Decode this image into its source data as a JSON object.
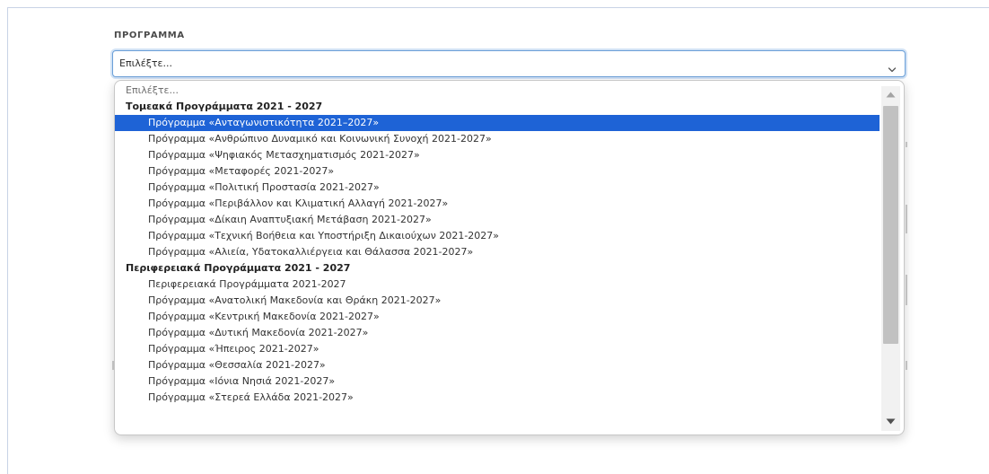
{
  "form": {
    "label": "ΠΡΟΓΡΑΜΜΑ",
    "selected_value": "Επιλέξτε..."
  },
  "dropdown": {
    "placeholder": "Επιλέξτε...",
    "groups": [
      {
        "label": "Τομεακά Προγράμματα 2021 - 2027",
        "options": [
          "Πρόγραμμα «Ανταγωνιστικότητα 2021–2027»",
          "Πρόγραμμα «Ανθρώπινο Δυναμικό και Κοινωνική Συνοχή 2021-2027»",
          "Πρόγραμμα «Ψηφιακός Μετασχηματισμός 2021-2027»",
          "Πρόγραμμα «Μεταφορές 2021-2027»",
          "Πρόγραμμα «Πολιτική Προστασία 2021-2027»",
          "Πρόγραμμα «Περιβάλλον και Κλιματική Αλλαγή 2021-2027»",
          "Πρόγραμμα «Δίκαιη Αναπτυξιακή Μετάβαση 2021-2027»",
          "Πρόγραμμα «Τεχνική Βοήθεια και Υποστήριξη Δικαιούχων 2021-2027»",
          "Πρόγραμμα «Αλιεία, Υδατοκαλλιέργεια και Θάλασσα 2021-2027»"
        ]
      },
      {
        "label": "Περιφερειακά Προγράμματα 2021 - 2027",
        "options": [
          "Περιφερειακά Προγράμματα 2021-2027",
          "Πρόγραμμα «Ανατολική Μακεδονία και Θράκη 2021-2027»",
          "Πρόγραμμα «Κεντρική Μακεδονία 2021-2027»",
          "Πρόγραμμα «Δυτική Μακεδονία 2021-2027»",
          "Πρόγραμμα «Ήπειρος 2021-2027»",
          "Πρόγραμμα «Θεσσαλία 2021-2027»",
          "Πρόγραμμα «Ιόνια Νησιά 2021-2027»",
          "Πρόγραμμα «Στερεά Ελλάδα 2021-2027»"
        ]
      }
    ],
    "highlighted_option": "Πρόγραμμα «Ανταγωνιστικότητα 2021–2027»",
    "scroll_position": 0,
    "colors": {
      "highlight": "#1e63d6",
      "focus_border": "#6a9fd8",
      "scrollbar_thumb": "#c1c1c1"
    },
    "icons": {
      "select": "chevron-down-icon",
      "scroll_up": "arrow-up-icon",
      "scroll_down": "arrow-down-icon"
    }
  }
}
